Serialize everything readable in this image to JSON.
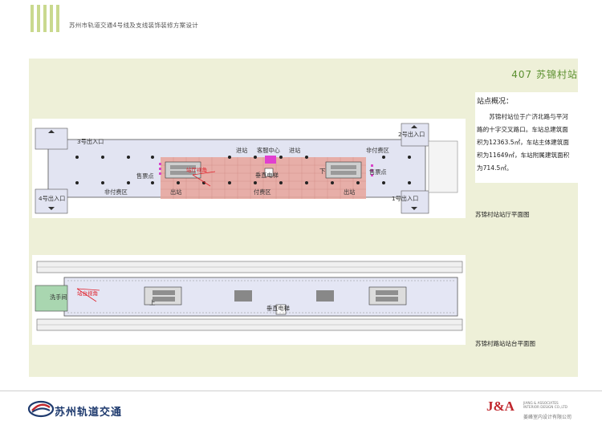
{
  "doc_title": "苏州市轨道交通4号线及支线装饰装修方案设计",
  "station_title": "407 苏锦村站",
  "overview": {
    "heading": "站点概况：",
    "body": "苏锦村站位于广济北路与平河路的十字交叉路口。车站总建筑面积为12363.5㎡，车站主体建筑面积为11649㎡，车站附属建筑面积为714.5㎡。"
  },
  "concourse": {
    "caption": "苏锦村站站厅平面图",
    "labels": {
      "exit3": "3号出入口",
      "exit2": "2号出入口",
      "exit4": "4号出入口",
      "exit1": "1号出入口",
      "entry_left": "进站",
      "entry_right": "进站",
      "service": "客服中心",
      "elevator": "垂直电梯",
      "unpaid_left": "非付费区",
      "unpaid_right_top": "非付费区",
      "ticket_left": "售票点",
      "ticket_right": "售票点",
      "exit_left": "出站",
      "paid": "付费区",
      "exit_right": "出站",
      "view": "站厅视角",
      "down": "下"
    }
  },
  "platform": {
    "caption": "苏锦村路站站台平面图",
    "labels": {
      "restroom": "洗手间",
      "view": "站台视角",
      "elevator": "垂直电梯",
      "up": "上"
    }
  },
  "footer": {
    "brand": "苏州轨道交通",
    "ja_logo": "J&A",
    "ja_en_1": "JIANG & ASSOCIATES",
    "ja_en_2": "INTERIOR DESIGN CO.,LTD",
    "ja_cn": "姜峰室内设计有限公司"
  },
  "colors": {
    "accent_green": "#5a8f2e",
    "bar_green": "#c9d98e",
    "panel_bg": "#eef0d8",
    "paid_zone": "#e8a8a0",
    "unpaid_zone": "#dcdcf0",
    "service_magenta": "#e040d0"
  }
}
